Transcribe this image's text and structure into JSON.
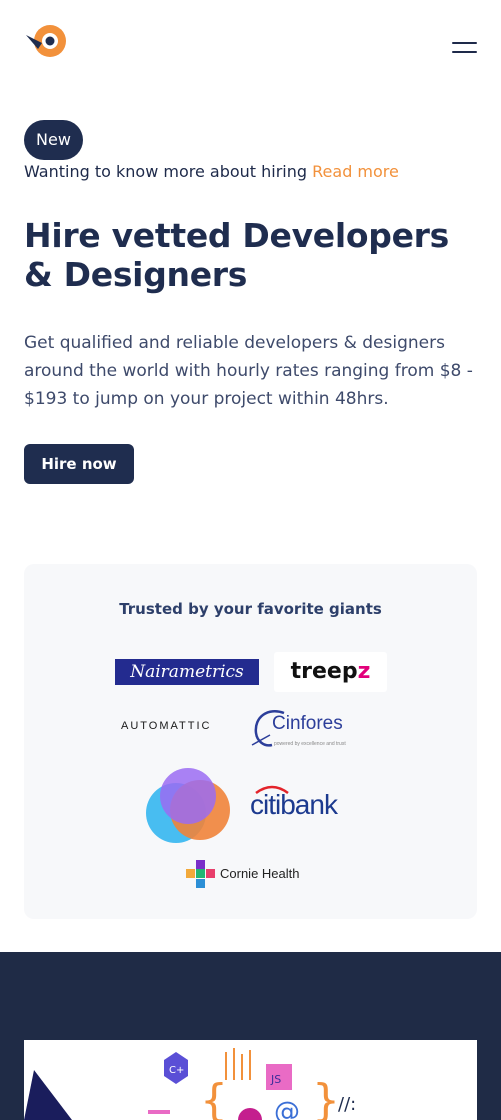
{
  "header": {
    "logo_icon": "brand-logo-icon",
    "menu_icon": "hamburger-menu-icon"
  },
  "notice": {
    "badge": "New",
    "text": "Wanting to know more about hiring",
    "link": "Read more"
  },
  "hero": {
    "title": "Hire vetted Developers & Designers",
    "description": "Get qualified and reliable developers & designers around the world with hourly rates ranging from $8 - $193 to jump on your project within 48hrs.",
    "cta_label": "Hire now"
  },
  "trusted": {
    "title": "Trusted by your favorite giants",
    "logos": {
      "nairametrics": "Nairametrics",
      "treepz_main": "treep",
      "treepz_z": "z",
      "automattic": "AUTOMATTIC",
      "cinfores": "Cinfores",
      "cinfores_tag": "powered by excellence and trust",
      "citi": "citi",
      "bank": "bank",
      "cornie": "Cornie Health"
    }
  },
  "banner": {
    "glyphs": {
      "cplus": "C+",
      "js": "JS",
      "at": "@",
      "slashes": "//:"
    }
  },
  "colors": {
    "primary": "#1f2d4f",
    "accent": "#f2913b",
    "dark_section": "#1f2b46",
    "card_bg": "#f7f8fa"
  }
}
